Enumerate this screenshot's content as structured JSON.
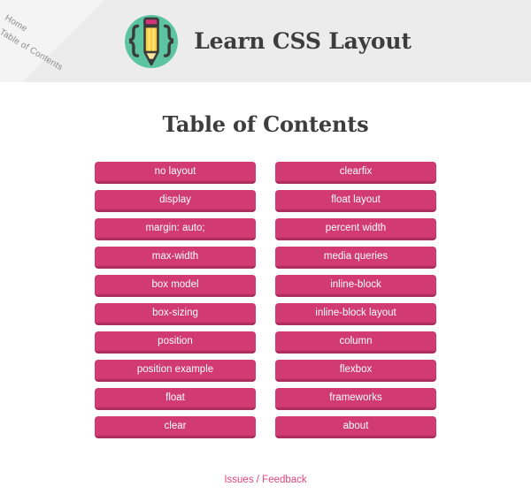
{
  "header": {
    "corner_links": [
      {
        "label": "Home",
        "name": "corner-link-home"
      },
      {
        "label": "Table of Contents",
        "name": "corner-link-table-of-contents"
      }
    ],
    "logo_icon": "css-braces-pencil-logo-icon",
    "site_title": "Learn CSS Layout"
  },
  "main": {
    "page_title": "Table of Contents",
    "columns": [
      {
        "name": "toc-column-left",
        "items": [
          "no layout",
          "display",
          "margin: auto;",
          "max-width",
          "box model",
          "box-sizing",
          "position",
          "position example",
          "float",
          "clear"
        ]
      },
      {
        "name": "toc-column-right",
        "items": [
          "clearfix",
          "float layout",
          "percent width",
          "media queries",
          "inline-block",
          "inline-block layout",
          "column",
          "flexbox",
          "frameworks",
          "about"
        ]
      }
    ]
  },
  "footer": {
    "link_label": "Issues / Feedback"
  },
  "colors": {
    "header_background": "#ececec",
    "ribbon_background": "#f4f4f4",
    "page_background": "#ffffff",
    "button_fill": "#d13a72",
    "button_shadow": "#ae2e5e",
    "button_text": "#ffffff",
    "heading_text": "#3d3d3d",
    "footer_link": "#e0457b",
    "logo_circle": "#5cc4a1",
    "logo_outline": "#3b3b3b",
    "pencil_body": "#f7cf3f",
    "pencil_body_light": "#fbe27c",
    "pencil_eraser": "#d6337a",
    "pencil_tip": "#fbe6a0",
    "corner_link_text": "#8e8e8e"
  }
}
